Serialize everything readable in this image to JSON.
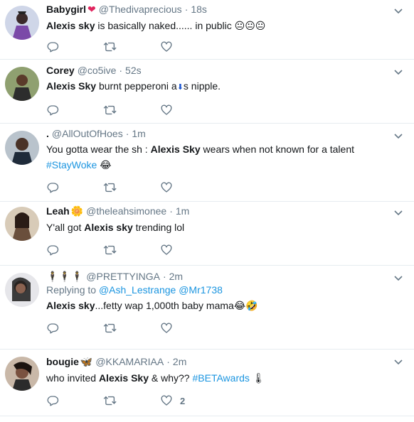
{
  "tweets": [
    {
      "name": "Babygirl",
      "name_emoji": "❤",
      "handle": "@Thedivaprecious",
      "time": "18s",
      "segments": [
        {
          "t": "Alexis sky",
          "b": true
        },
        {
          "t": " is basically naked...... in public ",
          "b": false
        }
      ],
      "trailing_emoji": "😐😐😐",
      "reply_count": "",
      "retweet_count": "",
      "like_count": ""
    },
    {
      "name": "Corey",
      "handle": "@co5ive",
      "time": "52s",
      "segments": [
        {
          "t": "Alexis Sky",
          "b": true
        },
        {
          "t": " burnt pepperoni a",
          "b": false
        },
        {
          "t": "⬇",
          "b": false
        },
        {
          "t": "s nipple.",
          "b": false
        }
      ],
      "reply_count": "",
      "retweet_count": "",
      "like_count": ""
    },
    {
      "name": ".",
      "handle": "@AllOutOfHoes",
      "time": "1m",
      "segments": [
        {
          "t": "You gotta wear the sh : ",
          "b": false
        },
        {
          "t": "Alexis Sky",
          "b": true
        },
        {
          "t": " wears when not known for a talent",
          "b": false
        }
      ],
      "hashtag": "#StayWoke",
      "trailing_emoji": "😂",
      "reply_count": "",
      "retweet_count": "",
      "like_count": ""
    },
    {
      "name": "Leah",
      "name_emoji": "🌼",
      "handle": "@theleahsimonee",
      "time": "1m",
      "segments": [
        {
          "t": "Y'all got ",
          "b": false
        },
        {
          "t": "Alexis sky",
          "b": true
        },
        {
          "t": " trending lol",
          "b": false
        }
      ],
      "reply_count": "",
      "retweet_count": "",
      "like_count": ""
    },
    {
      "name": "🕴🕴🕴",
      "handle": "@PRETTYINGA",
      "time": "2m",
      "reply_label": "Replying to",
      "reply_users": "@Ash_Lestrange @Mr1738",
      "segments": [
        {
          "t": "Alexis sky",
          "b": true
        },
        {
          "t": "...fetty wap 1,000th baby mama",
          "b": false
        }
      ],
      "trailing_emoji": "😂🤣",
      "reply_count": "",
      "retweet_count": "",
      "like_count": ""
    },
    {
      "name": "bougie",
      "name_emoji": "🦋",
      "handle": "@KKAMARIAA",
      "time": "2m",
      "segments": [
        {
          "t": "who invited ",
          "b": false
        },
        {
          "t": "Alexis Sky",
          "b": true
        },
        {
          "t": " & why?? ",
          "b": false
        }
      ],
      "hashtag": "#BETAwards",
      "trailing_emoji": "🌡",
      "reply_count": "",
      "retweet_count": "",
      "like_count": "2"
    }
  ],
  "colors": {
    "name": "#14171a",
    "secondary": "#657786",
    "link": "#1b95e0",
    "divider": "#e6ecf0",
    "heart": "#e0245e"
  },
  "icons": {
    "reply": "reply-icon",
    "retweet": "retweet-icon",
    "like": "heart-icon",
    "menu": "chevron-down-icon"
  }
}
